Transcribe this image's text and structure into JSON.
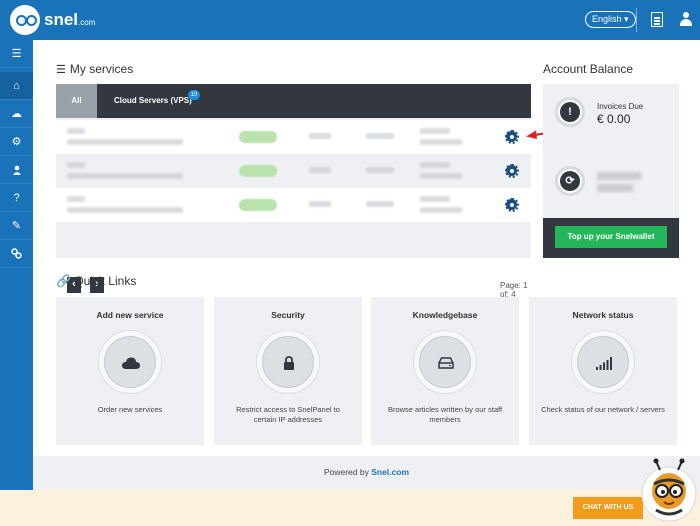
{
  "header": {
    "logo_text": "snel",
    "logo_suffix": ".com",
    "language": "English ▾"
  },
  "sidebar": {
    "items": [
      {
        "icon": "menu-icon",
        "glyph": "☰"
      },
      {
        "icon": "home-icon",
        "glyph": "⌂"
      },
      {
        "icon": "cloud-icon",
        "glyph": "☁"
      },
      {
        "icon": "settings-icon",
        "glyph": "⚙"
      },
      {
        "icon": "user-icon",
        "glyph": "👤"
      },
      {
        "icon": "help-icon",
        "glyph": "?"
      },
      {
        "icon": "edit-icon",
        "glyph": "✎"
      },
      {
        "icon": "link-icon",
        "glyph": "🔗"
      }
    ]
  },
  "services": {
    "title": "My services",
    "tabs": {
      "all": "All",
      "cloud": "Cloud Servers (VPS)",
      "cloud_count": "10"
    },
    "pagination": {
      "prev": "‹",
      "next": "›",
      "page_info": "Page: 1 of: 4"
    }
  },
  "balance": {
    "title": "Account Balance",
    "invoices_label": "Invoices Due",
    "invoices_value": "€ 0.00",
    "topup_label": "Top up your Snelwallet"
  },
  "quick_links": {
    "title": "Quick Links",
    "cards": [
      {
        "title": "Add new service",
        "desc": "Order new services",
        "icon": "cloud-icon"
      },
      {
        "title": "Security",
        "desc": "Restrict access to SnelPanel to certain IP addresses",
        "icon": "lock-icon"
      },
      {
        "title": "Knowledgebase",
        "desc": "Browse articles written by our staff members",
        "icon": "drive-icon"
      },
      {
        "title": "Network status",
        "desc": "Check status of our network / servers",
        "icon": "signal-icon"
      }
    ]
  },
  "footer": {
    "powered_prefix": "Powered by ",
    "powered_brand": "Snel.com"
  },
  "chat": {
    "label": "CHAT WITH US"
  },
  "colors": {
    "brand_blue": "#1a73b8",
    "dark": "#33373f",
    "green": "#25b65a",
    "orange": "#f39c1c"
  }
}
